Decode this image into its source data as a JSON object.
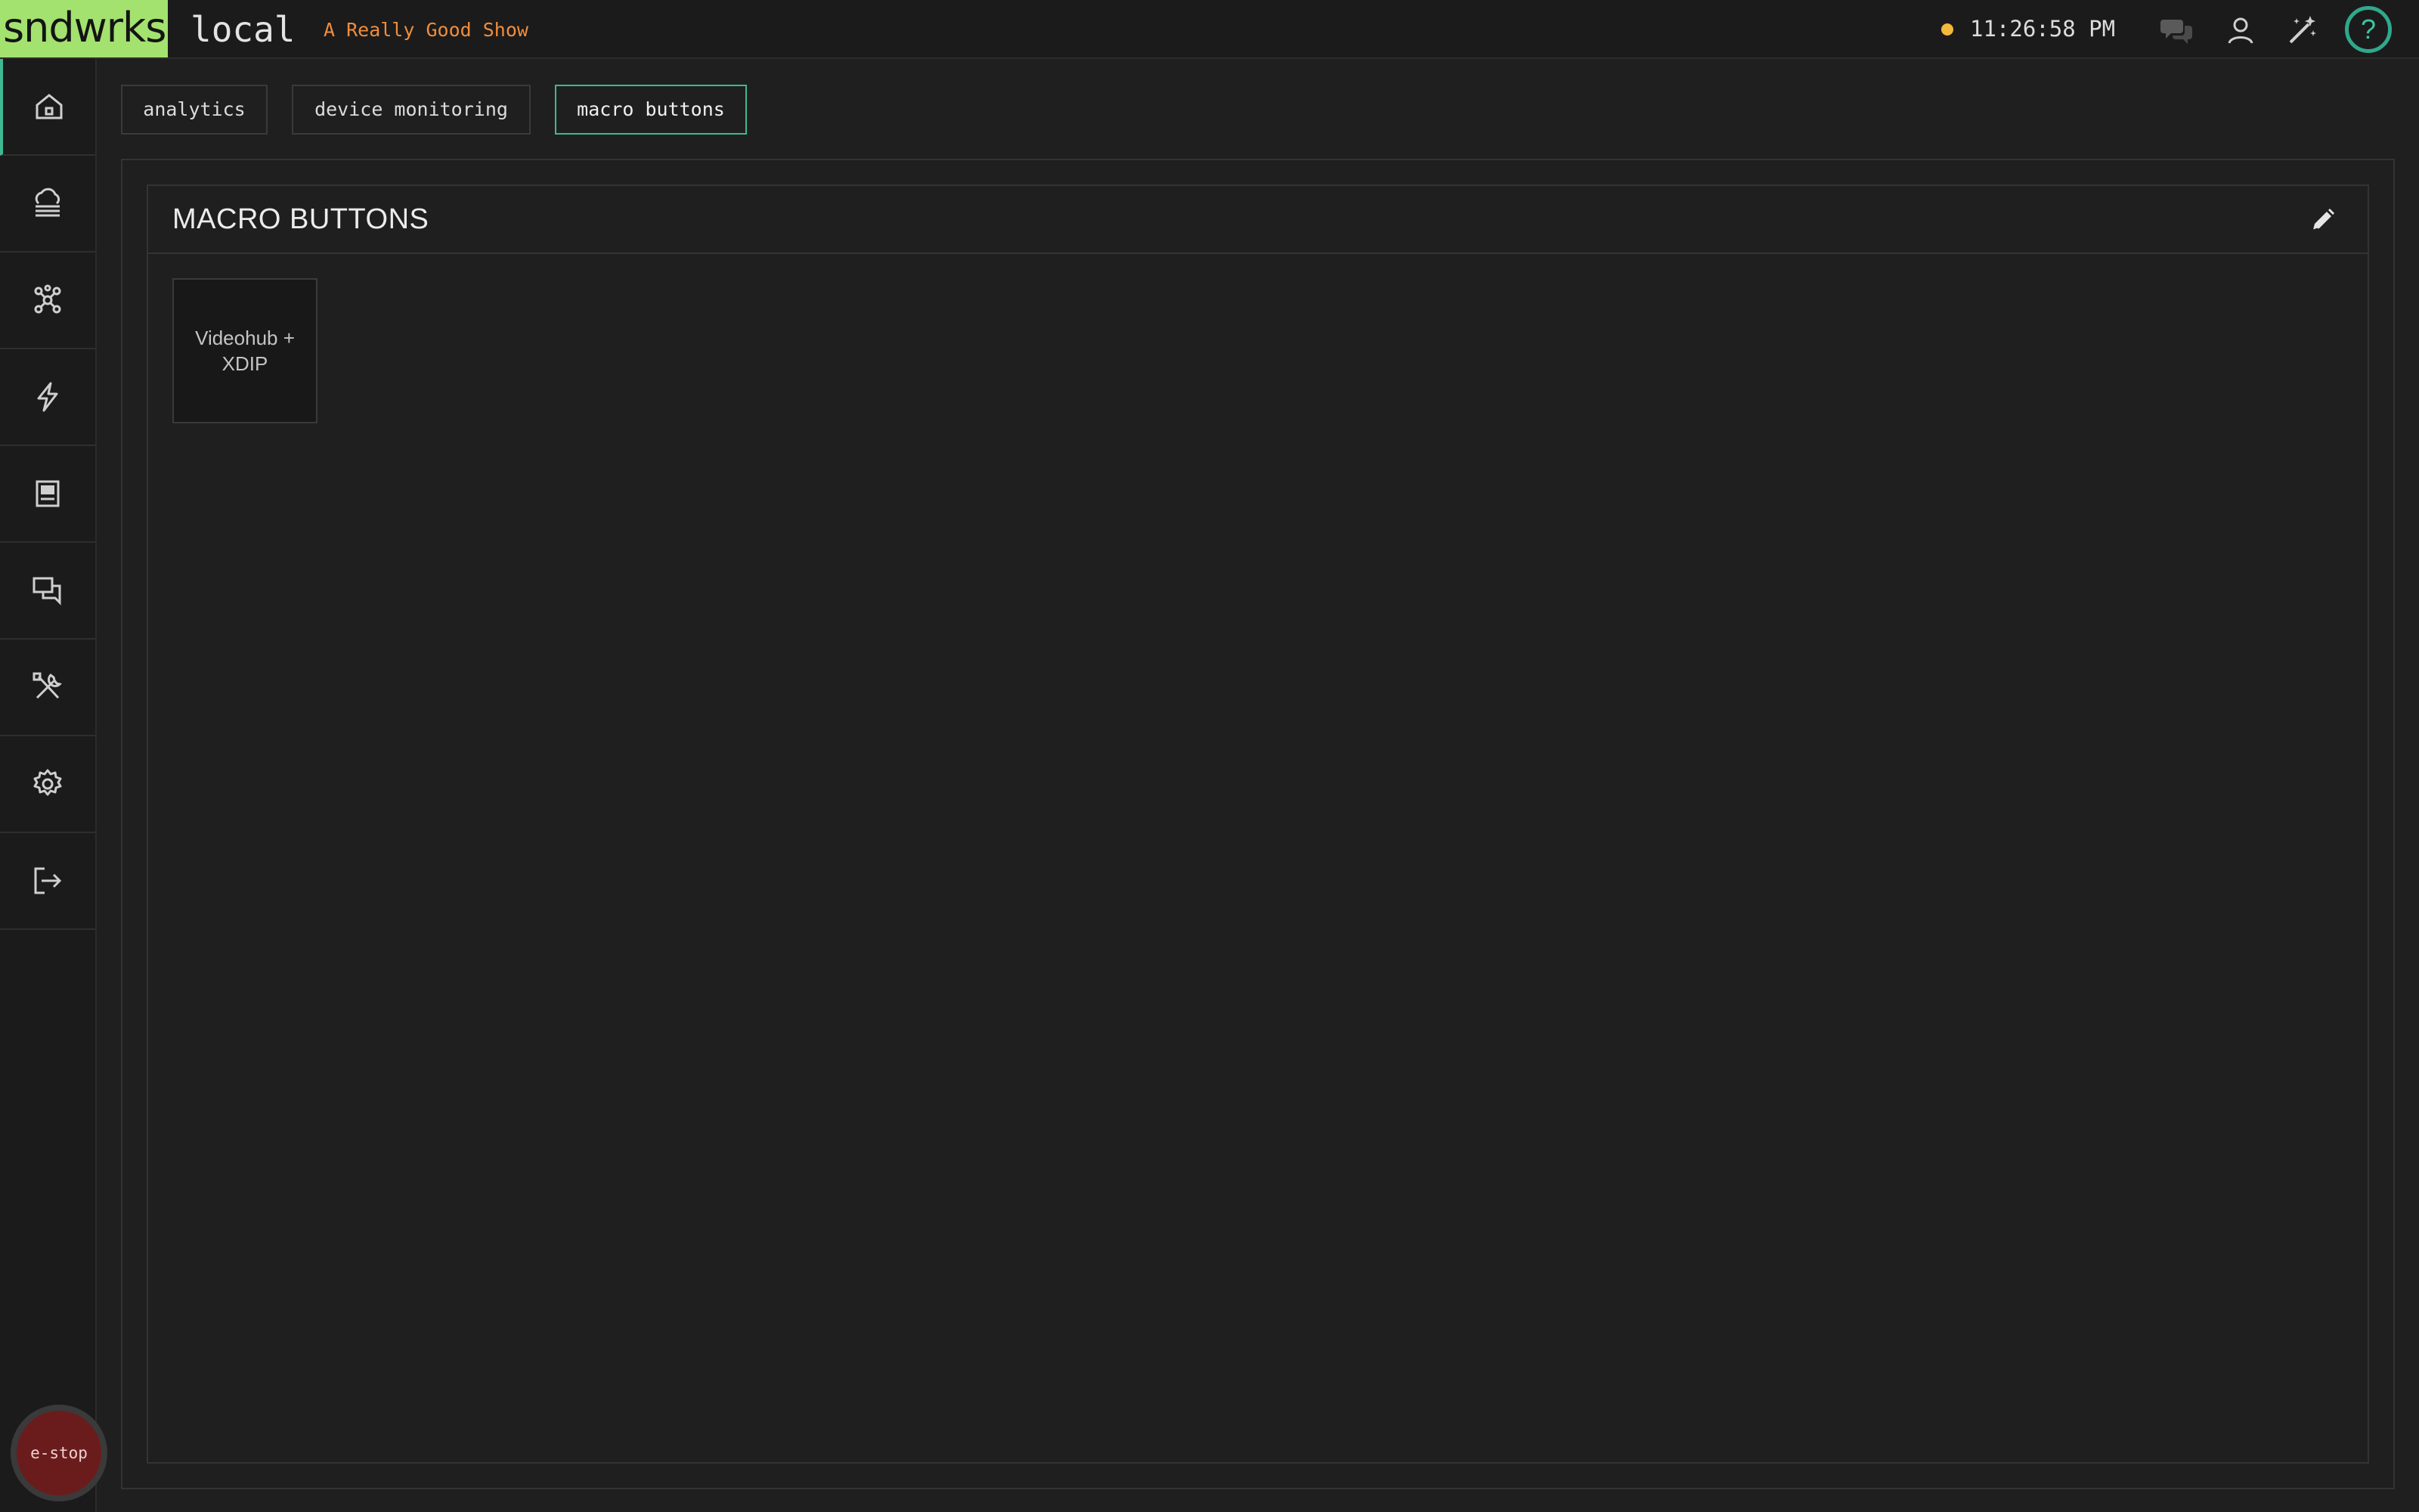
{
  "header": {
    "logo": "sndwrks",
    "environment": "local",
    "show_name": "A Really Good Show",
    "clock": "11:26:58 PM",
    "status_color": "#f2b93b",
    "icons": [
      "chat-icon",
      "user-icon",
      "magic-wand-icon",
      "help-icon"
    ],
    "help_label": "?"
  },
  "sidebar": {
    "items": [
      {
        "name": "home-icon",
        "active": true
      },
      {
        "name": "cloud-storage-icon"
      },
      {
        "name": "network-icon"
      },
      {
        "name": "lightning-icon"
      },
      {
        "name": "monitor-icon"
      },
      {
        "name": "messages-icon"
      },
      {
        "name": "tools-icon"
      },
      {
        "name": "gear-icon"
      },
      {
        "name": "logout-icon"
      }
    ],
    "estop_label": "e-stop"
  },
  "tabs": [
    {
      "label": "analytics"
    },
    {
      "label": "device monitoring"
    },
    {
      "label": "macro buttons",
      "active": true
    }
  ],
  "panel": {
    "title": "MACRO BUTTONS",
    "buttons": [
      {
        "label": "Videohub + XDIP"
      }
    ]
  },
  "colors": {
    "accent": "#3fb893",
    "logo_bg": "#a3e26f",
    "show_name": "#ef8d3d",
    "estop": "#6a1c1c"
  }
}
